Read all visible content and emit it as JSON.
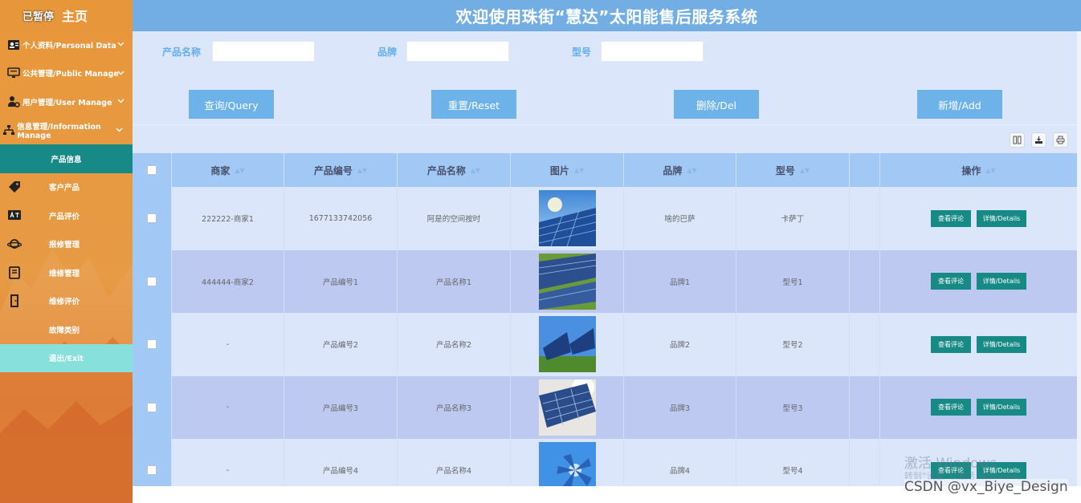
{
  "sidebar": {
    "paused_label": "已暂停",
    "home_label": "主页",
    "menus": [
      {
        "label": "个人资料/Personal Data",
        "icon": "profile-card-icon"
      },
      {
        "label": "公共管理/Public Manage",
        "icon": "monitor-icon"
      },
      {
        "label": "用户管理/User Manage",
        "icon": "user-gear-icon"
      },
      {
        "label": "信息管理/Information Manage",
        "icon": "sitemap-icon"
      }
    ],
    "sub_items": [
      {
        "label": "产品信息",
        "icon": "",
        "active": true
      },
      {
        "label": "客户产品",
        "icon": "tag-icon"
      },
      {
        "label": "产品评价",
        "icon": "translate-icon"
      },
      {
        "label": "报修管理",
        "icon": "planet-icon"
      },
      {
        "label": "维修管理",
        "icon": "book-icon"
      },
      {
        "label": "维修评价",
        "icon": "door-icon"
      },
      {
        "label": "故障类别",
        "icon": ""
      },
      {
        "label": "退出/Exit",
        "icon": ""
      }
    ]
  },
  "header": {
    "title": "欢迎使用珠街“慧达”太阳能售后服务系统"
  },
  "search": {
    "fields": [
      {
        "label": "产品名称",
        "value": ""
      },
      {
        "label": "品牌",
        "value": ""
      },
      {
        "label": "型号",
        "value": ""
      }
    ],
    "buttons": [
      "查询/Query",
      "重置/Reset",
      "删除/Del",
      "新增/Add"
    ]
  },
  "toolbar": {
    "icons": [
      "column-toggle-icon",
      "export-icon",
      "print-icon"
    ]
  },
  "table": {
    "columns": [
      "商家",
      "产品编号",
      "产品名称",
      "图片",
      "品牌",
      "型号",
      "",
      "操作"
    ],
    "rows": [
      {
        "merchant": "222222-商家1",
        "code": "1677133742056",
        "name": "阿是的空间按时",
        "brand": "啥的巴萨",
        "model": "卡萨丁"
      },
      {
        "merchant": "444444-商家2",
        "code": "产品编号1",
        "name": "产品名称1",
        "brand": "品牌1",
        "model": "型号1"
      },
      {
        "merchant": "-",
        "code": "产品编号2",
        "name": "产品名称2",
        "brand": "品牌2",
        "model": "型号2"
      },
      {
        "merchant": "-",
        "code": "产品编号3",
        "name": "产品名称3",
        "brand": "品牌3",
        "model": "型号3"
      },
      {
        "merchant": "-",
        "code": "产品编号4",
        "name": "产品名称4",
        "brand": "品牌4",
        "model": "型号4"
      }
    ],
    "action_view": "查看评论",
    "action_detail": "详情/Details"
  },
  "watermark": {
    "line1": "激活 Windows",
    "line2": "转到“设置”以激活 Windows。"
  },
  "credit": "CSDN @vx_Biye_Design"
}
